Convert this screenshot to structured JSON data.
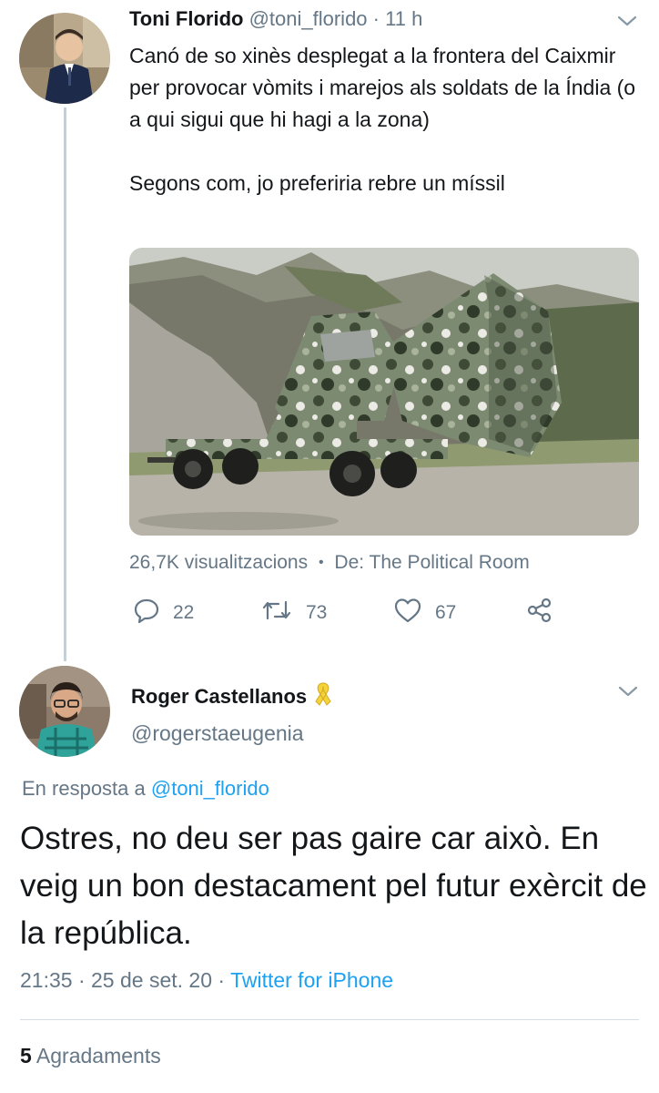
{
  "tweet": {
    "author_name": "Toni Florido",
    "handle": "@toni_florido",
    "separator": "·",
    "time": "11 h",
    "text": "Canó de so xinès desplegat a la frontera del Caixmir per provocar vòmits i marejos als soldats de la Índia (o a qui sigui que hi hagi a la zona)\n\nSegons com, jo preferiria rebre un míssil",
    "views": "26,7K visualitzacions",
    "meta_sep": "•",
    "source": "De: The Political Room",
    "replies": "22",
    "retweets": "73",
    "likes": "67"
  },
  "reply": {
    "author_name": "Roger Castellanos",
    "handle": "@rogerstaeugenia",
    "reply_prefix": "En resposta a ",
    "reply_to": "@toni_florido",
    "text": "Ostres, no deu ser pas gaire car això. En veig un bon destacament pel futur exèrcit de la república.",
    "time": "21:35",
    "date": "25 de set. 20",
    "client": "Twitter for iPhone",
    "sep": "·",
    "like_count": "5",
    "like_label": "Agradaments"
  },
  "icons": {
    "reply": "reply-icon",
    "retweet": "retweet-icon",
    "like": "heart-icon",
    "share": "share-icon",
    "menu": "chevron-down-icon",
    "ribbon": "yellow-ribbon-icon"
  },
  "colors": {
    "link": "#1da1f2",
    "muted": "#657786",
    "text": "#14171a",
    "thread_line": "#c4cfd6",
    "ribbon": "#f5d33b"
  }
}
